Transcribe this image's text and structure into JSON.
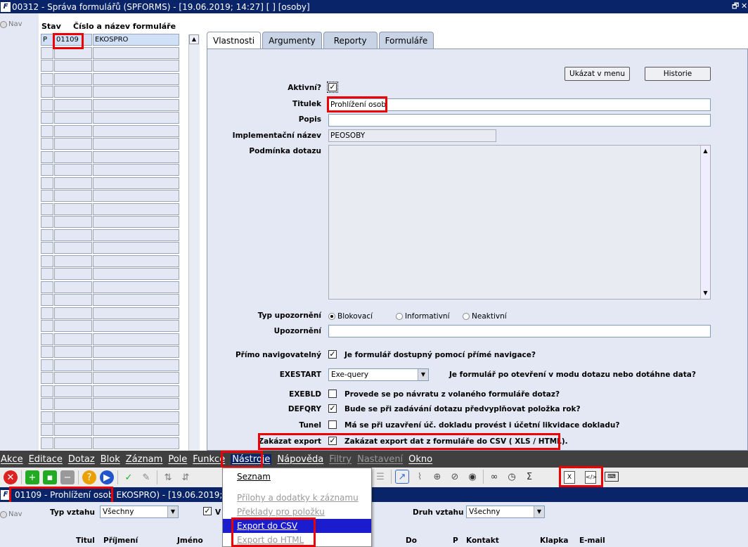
{
  "window": {
    "title": "00312 - Správa formulářů (SPFORMS) - [19.06.2019; 14:27] [ ] [osoby]",
    "close_label": "✕",
    "restore_label": "🗗"
  },
  "nav": {
    "label": "Nav"
  },
  "grid": {
    "header_stav": "Stav",
    "header_name": "Číslo a název formuláře",
    "rows": [
      {
        "stav": "P",
        "cislo": "01109",
        "nazev": "EKOSPRO"
      }
    ]
  },
  "tabs": [
    "Vlastnosti",
    "Argumenty",
    "Reporty",
    "Formuláře"
  ],
  "buttons": {
    "menu": "Ukázat v menu",
    "history": "Historie"
  },
  "form": {
    "aktivni_label": "Aktivní?",
    "titulek_label": "Titulek",
    "titulek_value": "Prohlížení osob",
    "popis_label": "Popis",
    "impl_label": "Implementační název",
    "impl_value": "PEOSOBY",
    "podminka_label": "Podmínka dotazu",
    "typ_label": "Typ upozornění",
    "typ_options": [
      "Blokovací",
      "Informativní",
      "Neaktivní"
    ],
    "upozorneni_label": "Upozornění",
    "primo_label": "Přímo navigovatelný",
    "primo_desc": "Je formulář dostupný pomocí přímé navigace?",
    "exestart_label": "EXESTART",
    "exestart_value": "Exe-query",
    "exestart_desc": "Je formulář po otevření v modu dotazu nebo dotáhne data?",
    "exebld_label": "EXEBLD",
    "exebld_desc": "Provede se po návratu z volaného formuláře dotaz?",
    "defqry_label": "DEFQRY",
    "defqry_desc": "Bude se při zadávání dotazu předvyplňovat položka rok?",
    "tunel_label": "Tunel",
    "tunel_desc": "Má se při uzavření úč. dokladu provést i účetní likvidace dokladu?",
    "zakazat_label": "Zakázat export",
    "zakazat_desc": "Zakázat export dat z formuláře do CSV ( XLS / HTML)."
  },
  "menubar": [
    "Akce",
    "Editace",
    "Dotaz",
    "Blok",
    "Záznam",
    "Pole",
    "Funkce",
    "Nástroje",
    "Nápověda",
    "Filtry",
    "Nastavení",
    "Okno"
  ],
  "dropdown": [
    "Seznam",
    "Přílohy a dodatky k záznamu",
    "Překlady pro položku",
    "Export do CSV",
    "Export do HTML"
  ],
  "window2": {
    "title_box": "01109 - Prohlížení osob",
    "title_rest": "EKOSPRO) - [19.06.2019;"
  },
  "lower": {
    "typ_vztahu_label": "Typ vztahu",
    "typ_vztahu_value": "Všechny",
    "druh_vztahu_label": "Druh vztahu",
    "druh_vztahu_value": "Všechny",
    "v_label": "V",
    "columns": [
      "Titul",
      "Příjmení",
      "Jméno",
      "Do",
      "P",
      "Kontakt",
      "Klapka",
      "E-mail"
    ]
  },
  "colors": {
    "titlebar": "#0a246a",
    "panel": "#e3e8f4",
    "highlight": "#e00000",
    "menu_bg": "#404040"
  }
}
